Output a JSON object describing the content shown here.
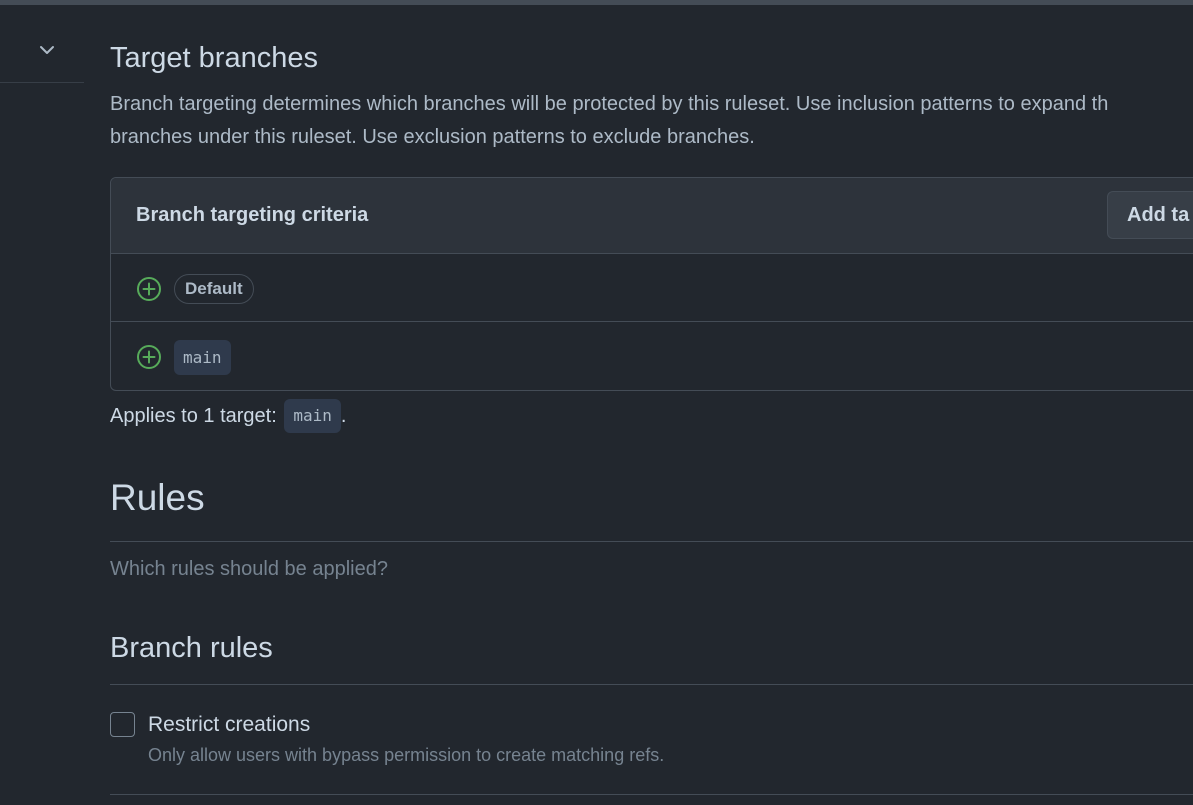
{
  "sections": {
    "target_branches": {
      "title": "Target branches",
      "description_line1": "Branch targeting determines which branches will be protected by this ruleset. Use inclusion patterns to expand th",
      "description_line2": "branches under this ruleset. Use exclusion patterns to exclude branches."
    },
    "criteria": {
      "title": "Branch targeting criteria",
      "add_target_label": "Add ta",
      "rows": [
        {
          "icon": "plus-circle-icon",
          "label": "Default",
          "style": "pill"
        },
        {
          "icon": "plus-circle-icon",
          "label": "main",
          "style": "code"
        }
      ]
    },
    "applies": {
      "text": "Applies to 1 target:",
      "target": "main",
      "suffix": "."
    },
    "rules": {
      "title": "Rules",
      "subtitle": "Which rules should be applied?"
    },
    "branch_rules": {
      "title": "Branch rules",
      "items": [
        {
          "label": "Restrict creations",
          "description": "Only allow users with bypass permission to create matching refs.",
          "checked": false
        }
      ]
    }
  },
  "colors": {
    "background": "#22272e",
    "header_bg": "#2d333b",
    "border": "#444c56",
    "text": "#cdd9e5",
    "muted": "#768390",
    "success": "#57ab5a"
  }
}
